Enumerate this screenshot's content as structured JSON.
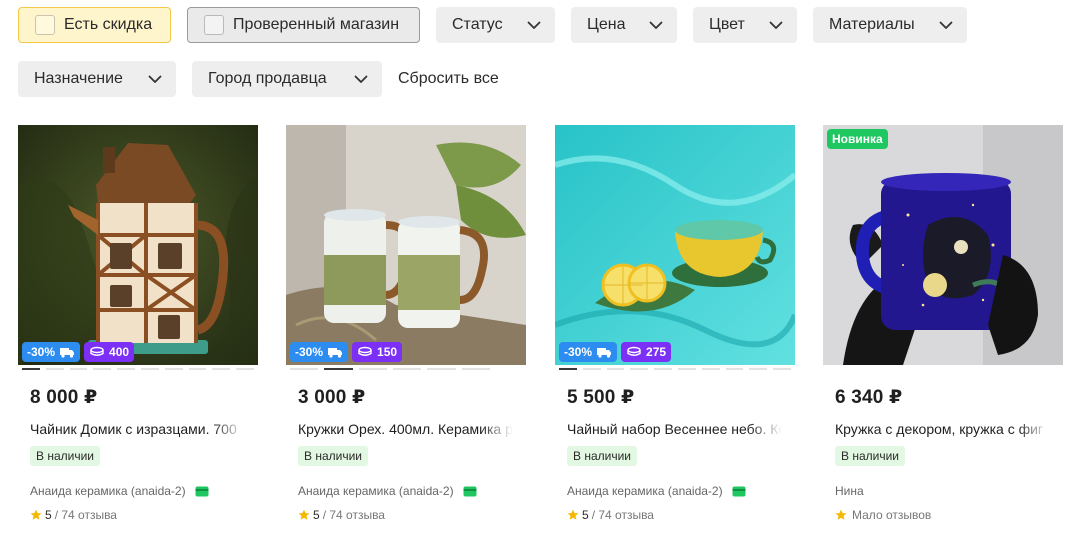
{
  "filters": {
    "row1": [
      {
        "label": "Есть скидка",
        "type": "checkbox",
        "checked": false
      },
      {
        "label": "Проверенный магазин",
        "type": "checkbox",
        "checked": false
      },
      {
        "label": "Статус",
        "type": "dropdown"
      },
      {
        "label": "Цена",
        "type": "dropdown"
      },
      {
        "label": "Цвет",
        "type": "dropdown"
      },
      {
        "label": "Материалы",
        "type": "dropdown"
      }
    ],
    "row2": [
      {
        "label": "Назначение",
        "type": "dropdown"
      },
      {
        "label": "Город продавца",
        "type": "dropdown"
      }
    ],
    "reset_label": "Сбросить все"
  },
  "colors": {
    "discount_badge": "#2d8cf0",
    "bonus_badge": "#7b2ff7",
    "new_badge": "#1ec760",
    "stock_bg": "#e3f8e3",
    "star": "#f5b800",
    "card_icon": "#1ec760"
  },
  "products": [
    {
      "image": "teapot-house",
      "discount_badge": "-30%",
      "bonus_badge": "400",
      "new_badge": null,
      "price": "8 000 ₽",
      "title": "Чайник Домик с изразцами. 700",
      "stock": "В наличии",
      "seller": "Анаида керамика (anaida-2)",
      "card_payment_icon": true,
      "rating_score": "5",
      "rating_text": "/ 74 отзыва",
      "slides": 10,
      "active_slide": 0
    },
    {
      "image": "mugs-walnut",
      "discount_badge": "-30%",
      "bonus_badge": "150",
      "new_badge": null,
      "price": "3 000 ₽",
      "title": "Кружки Орех. 400мл. Керамика р",
      "stock": "В наличии",
      "seller": "Анаида керамика (anaida-2)",
      "card_payment_icon": true,
      "rating_score": "5",
      "rating_text": "/ 74 отзыва",
      "slides": 6,
      "active_slide": 1
    },
    {
      "image": "tea-set-lemon",
      "discount_badge": "-30%",
      "bonus_badge": "275",
      "new_badge": null,
      "price": "5 500 ₽",
      "title": "Чайный набор Весеннее небо. Ке",
      "stock": "В наличии",
      "seller": "Анаида керамика (anaida-2)",
      "card_payment_icon": true,
      "rating_score": "5",
      "rating_text": "/ 74 отзыва",
      "slides": 10,
      "active_slide": 0
    },
    {
      "image": "mug-dragon",
      "discount_badge": null,
      "bonus_badge": null,
      "new_badge": "Новинка",
      "price": "6 340 ₽",
      "title": "Кружка с декором, кружка с фиг",
      "stock": "В наличии",
      "seller": "Нина",
      "card_payment_icon": false,
      "rating_score": "",
      "rating_text": "Мало отзывов",
      "slides": 0,
      "active_slide": 0
    }
  ]
}
